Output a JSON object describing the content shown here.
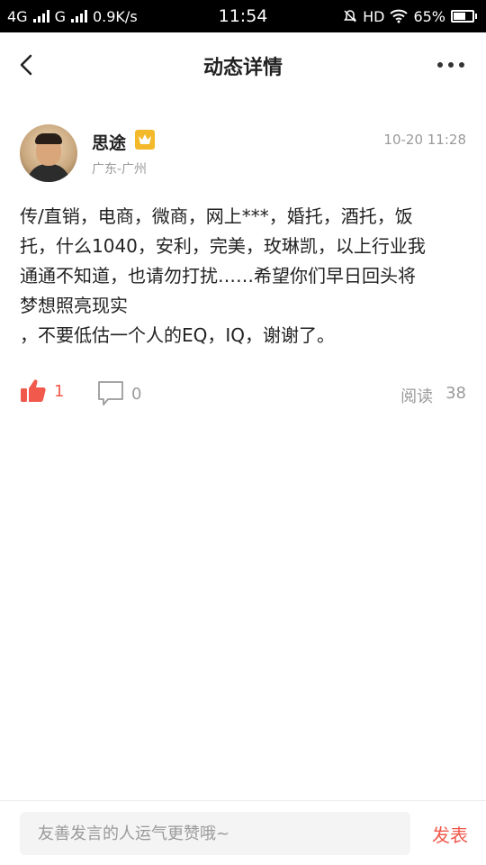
{
  "status_bar": {
    "network1": "4G",
    "network2": "G",
    "speed": "0.9K/s",
    "time": "11:54",
    "hd": "HD",
    "battery_percent": "65%",
    "battery_level": 0.65
  },
  "nav": {
    "title": "动态详情"
  },
  "post": {
    "username": "思途",
    "location": "广东-广州",
    "time": "10-20 11:28",
    "content": "传/直销，电商，微商，网上***，婚托，酒托，饭\n托，什么1040，安利，完美，玫琳凯，以上行业我\n通通不知道，也请勿打扰……希望你们早日回头将\n梦想照亮现实\n，不要低估一个人的EQ，IQ，谢谢了。",
    "likes": "1",
    "comments": "0",
    "reads_label": "阅读",
    "reads": "38"
  },
  "bottom": {
    "placeholder": "友善发言的人运气更赞哦~",
    "send_label": "发表"
  },
  "colors": {
    "accent": "#f0594c",
    "vip": "#f3b92a"
  }
}
